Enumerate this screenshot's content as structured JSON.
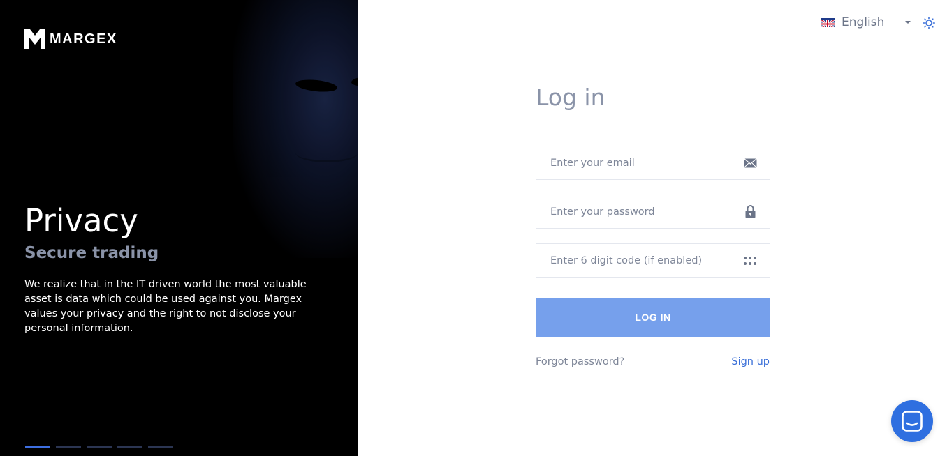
{
  "brand": {
    "name": "MARGEX"
  },
  "hero": {
    "title": "Privacy",
    "subtitle": "Secure trading",
    "text": "We realize that in the IT driven world the most valuable asset is data which could be used against you. Margex values your privacy and the right to not disclose your personal information.",
    "slides_total": 5,
    "active_slide": 1
  },
  "header": {
    "language": "English",
    "language_flag_icon": "uk-flag-icon",
    "theme_icon": "sun-icon"
  },
  "login": {
    "title": "Log in",
    "email_placeholder": "Enter your email",
    "password_placeholder": "Enter your password",
    "code_placeholder": "Enter 6 digit code (if enabled)",
    "button_label": "LOG IN",
    "forgot_label": "Forgot password?",
    "signup_label": "Sign up"
  },
  "colors": {
    "accent": "#76a0ec",
    "link": "#3a6fd8",
    "chat": "#2f6fe0",
    "hero_bg": "#000000"
  }
}
